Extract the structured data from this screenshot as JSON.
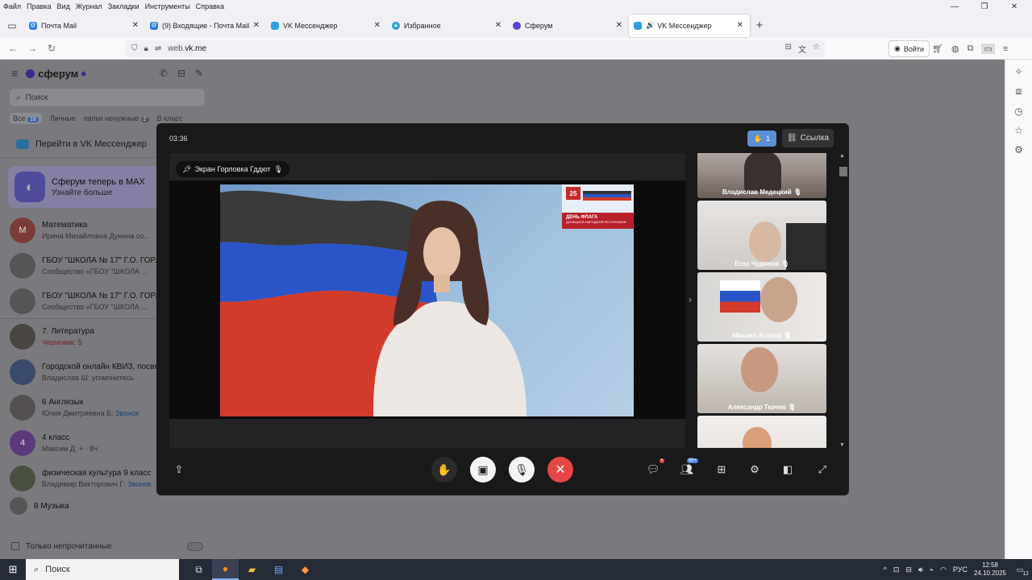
{
  "menu": [
    "Файл",
    "Правка",
    "Вид",
    "Журнал",
    "Закладки",
    "Инструменты",
    "Справка"
  ],
  "window_controls": [
    "—",
    "❐",
    "✕"
  ],
  "tabs": [
    {
      "label": "Почта Mail",
      "color": "#2a7ae2",
      "active": false
    },
    {
      "label": "(9) Входящие - Почта Mail",
      "color": "#2a7ae2",
      "active": false
    },
    {
      "label": "VK Мессенджер",
      "color": "#2ea0e0",
      "active": false
    },
    {
      "label": "Избранное",
      "color": "#2aa3d6",
      "active": false
    },
    {
      "label": "Сферум",
      "color": "#5b3fd6",
      "active": false
    },
    {
      "label": "VK Мессенджер",
      "color": "#2ea0e0",
      "active": true
    }
  ],
  "url": {
    "prefix": "web.",
    "domain": "vk.me"
  },
  "login_label": "Войти",
  "app": {
    "brand": "сферум",
    "search_placeholder": "Поиск",
    "filters": {
      "all": "Все",
      "all_count": "18",
      "personal": "Личные",
      "folder": "папки ненужные",
      "folder_count": "2",
      "other": "В класс"
    },
    "goto_vk": "Перейти в VK Мессенджер",
    "promo": {
      "title": "Сферум теперь в MAX",
      "subtitle": "Узнайте больше"
    },
    "chats": [
      {
        "name": "Математика",
        "sub": "Ирина Михайловна Дунина со...",
        "avatar_text": "М",
        "avatar_color": "#7a3c38"
      },
      {
        "name": "ГБОУ \"ШКОЛА № 17\" Г.О. ГОРЛО",
        "sub": "Сообщество «ГБОУ \"ШКОЛА ...",
        "avatar_text": "",
        "avatar_color": "#555"
      },
      {
        "name": "ГБОУ \"ШКОЛА № 17\" Г.О. ГОРЛО",
        "sub": "Сообщество «ГБОУ \"ШКОЛА ...",
        "avatar_text": "",
        "avatar_color": "#555"
      },
      {
        "name": "7. Литература",
        "sub_red": "Черновик:",
        "sub": " 5",
        "avatar_text": "",
        "avatar_color": "#4a4540"
      },
      {
        "name": "Городской онлайн КВИЗ, посвя",
        "sub": "Владислав Ш: угомонитесь",
        "avatar_text": "",
        "avatar_color": "#3a4a6a"
      },
      {
        "name": "6 Англязык",
        "sub": "Юлия Дмитриевна Б: ",
        "sub_blue": "Звонок",
        "avatar_text": "",
        "avatar_color": "#555050"
      },
      {
        "name": "4 класс",
        "sub": "Максим Д: + · 8ч",
        "avatar_text": "4",
        "avatar_color": "#5a3a7a"
      },
      {
        "name": "физическая культура 9 класс",
        "sub": "Владимир Викторович Г: ",
        "sub_blue": "Звонок",
        "sub_tail": " · 25м",
        "avatar_text": "",
        "avatar_color": "#4a5040"
      },
      {
        "name": "8 Музыка",
        "sub": "",
        "avatar_text": "",
        "avatar_color": "#555"
      }
    ],
    "only_unread": "Только непрочитанные"
  },
  "call": {
    "timer": "03:36",
    "raised_hands": "1",
    "link_label": "Ссылка",
    "screen_label": "Экран Горловка Гддют",
    "poster": {
      "day": "25",
      "title": "ДЕНЬ ФЛАГА",
      "subtitle": "ДОНЕЦКОЙ НАРОДНОЙ РЕСПУБЛИКИ"
    },
    "participants": [
      {
        "name": "Владислав Медецкий"
      },
      {
        "name": "Егор Чудинов"
      },
      {
        "name": "Михаил Агапов"
      },
      {
        "name": "Александр Ткачев"
      },
      {
        "name": ""
      }
    ],
    "chat_badge": "•",
    "participants_badge": "99+"
  },
  "taskbar": {
    "search": "Поиск",
    "lang": "РУС",
    "time": "12:58",
    "date": "24.10.2025",
    "notif_count": "12"
  }
}
